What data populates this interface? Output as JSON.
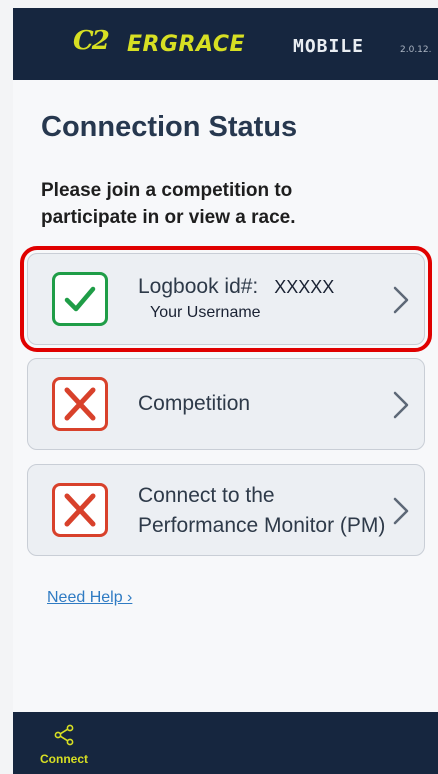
{
  "header": {
    "logo_mark": "C2",
    "brand_name": "ERGRACE",
    "brand_suffix": "MOBILE",
    "version": "2.0.12."
  },
  "main": {
    "title": "Connection Status",
    "subtitle": "Please join a competition to participate in or view a race."
  },
  "cards": [
    {
      "status": "ok",
      "label": "Logbook id#:",
      "value": "XXXXX",
      "sub": "Your Username",
      "icon": "check-icon"
    },
    {
      "status": "fail",
      "label": "Competition",
      "icon": "x-icon"
    },
    {
      "status": "fail",
      "line1": "Connect to the",
      "line2": "Performance Monitor (PM)",
      "icon": "x-icon"
    }
  ],
  "help": {
    "label": "Need Help ›"
  },
  "bottom_nav": {
    "items": [
      {
        "label": "Connect",
        "icon": "share-icon"
      }
    ]
  },
  "colors": {
    "header_bg": "#16263f",
    "accent": "#d7df23",
    "ok": "#1f9d47",
    "fail": "#d8412b",
    "highlight": "#e00000",
    "link": "#2f7bc3"
  }
}
